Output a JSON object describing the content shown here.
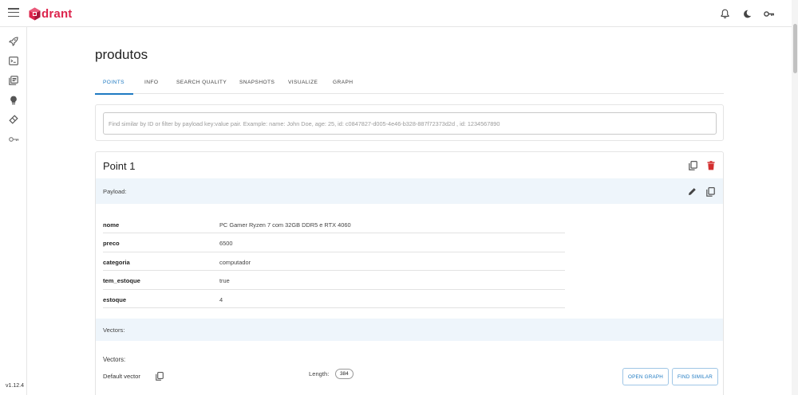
{
  "app": {
    "logo_text": "drant",
    "version": "v1.12.4",
    "brand_color": "#dc244c",
    "accent_color": "#1f7ac2"
  },
  "topbar": {
    "icons": [
      "menu-icon",
      "bell-icon",
      "moon-icon",
      "key-icon"
    ]
  },
  "sidebar": {
    "icons": [
      "rocket-icon",
      "terminal-icon",
      "collections-icon",
      "lightbulb-icon",
      "datasets-icon",
      "key-icon"
    ]
  },
  "collection": {
    "title": "produtos",
    "tabs": [
      {
        "label": "POINTS",
        "active": true
      },
      {
        "label": "INFO",
        "active": false
      },
      {
        "label": "SEARCH QUALITY",
        "active": false
      },
      {
        "label": "SNAPSHOTS",
        "active": false
      },
      {
        "label": "VISUALIZE",
        "active": false
      },
      {
        "label": "GRAPH",
        "active": false
      }
    ]
  },
  "search": {
    "placeholder": "Find similar by ID or filter by payload key:value pair. Example: name: John Doe, age: 25, id: c0847827-d005-4e46-b328-887f72373d2d , id: 1234567890"
  },
  "point": {
    "title": "Point 1",
    "payload_label": "Payload:",
    "payload": [
      {
        "key": "nome",
        "value": "PC Gamer Ryzen 7 com 32GB DDR5 e RTX 4060"
      },
      {
        "key": "preco",
        "value": "6500"
      },
      {
        "key": "categoria",
        "value": "computador"
      },
      {
        "key": "tem_estoque",
        "value": "true"
      },
      {
        "key": "estoque",
        "value": "4"
      }
    ],
    "vectors_section_label": "Vectors:",
    "vectors_heading": "Vectors:",
    "vector_name": "Default vector",
    "length_label": "Length:",
    "length_value": "384",
    "open_graph_label": "OPEN GRAPH",
    "find_similar_label": "FIND SIMILAR"
  }
}
